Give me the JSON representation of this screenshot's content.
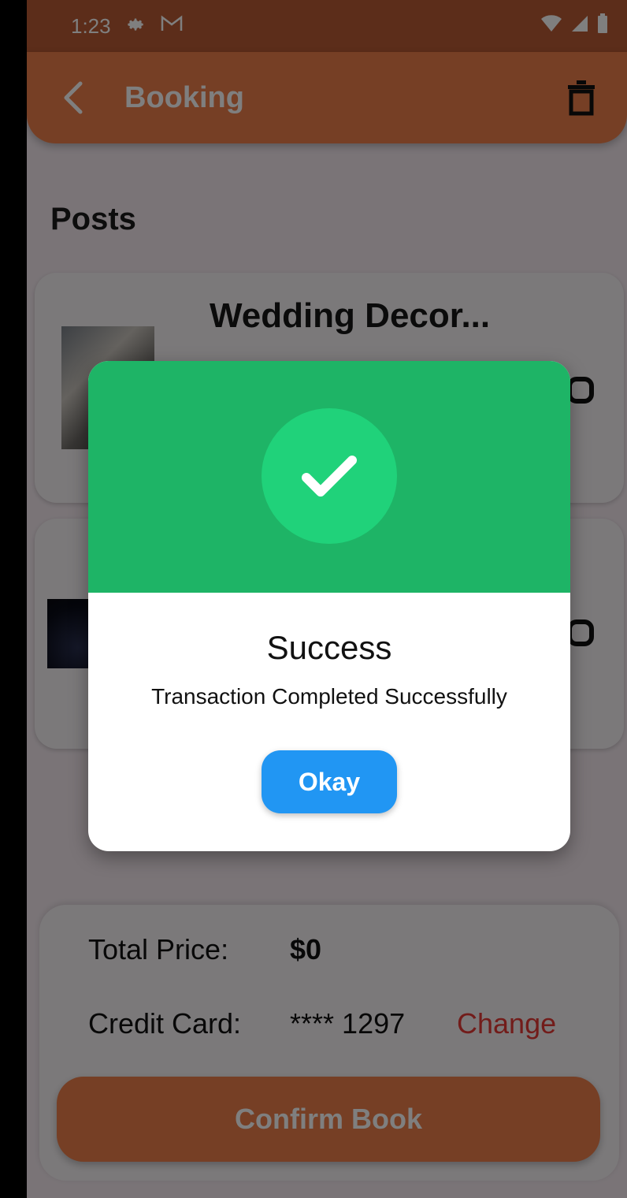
{
  "status_bar": {
    "time": "1:23",
    "icons": [
      "settings-icon",
      "gmail-icon",
      "wifi-icon",
      "signal-icon",
      "battery-icon"
    ]
  },
  "app_bar": {
    "title": "Booking",
    "back_icon": "chevron-left-icon",
    "action_icon": "trash-icon"
  },
  "section": {
    "title": "Posts"
  },
  "posts": [
    {
      "title": "Wedding Decor...",
      "subtitle": ""
    },
    {
      "title": "",
      "subtitle": ""
    }
  ],
  "summary": {
    "total_label": "Total Price:",
    "total_value": "$0",
    "card_label": "Credit Card:",
    "card_value": "**** 1297",
    "change_label": "Change",
    "confirm_label": "Confirm Book"
  },
  "dialog": {
    "icon": "checkmark-icon",
    "title": "Success",
    "message": "Transaction Completed Successfully",
    "button_label": "Okay"
  },
  "colors": {
    "primary": "#ed7f4b",
    "status_bar": "#b85a34",
    "success_header": "#1eb466",
    "success_circle": "#20d27a",
    "okay_button": "#2196f3",
    "change_link": "#e53935"
  }
}
